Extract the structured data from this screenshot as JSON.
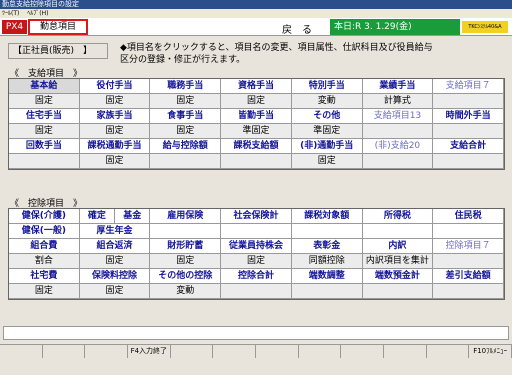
{
  "window": {
    "title": "勤怠支給控除項目の設定"
  },
  "menubar": {
    "items": [
      "ﾂｰﾙ(T)",
      "ﾍﾙﾌﾟ(H)"
    ]
  },
  "header": {
    "tag": "PX4",
    "mode": "勤怠項目",
    "back": "戻　る",
    "today": "本日:R 3. 1.29(金)",
    "system": "TKCｼｽﾃﾑ40&A"
  },
  "staff_category": "【正社員(販売)　】",
  "instruction": "◆項目名をクリックすると、項目名の変更、項目属性、仕訳科目及び役員給与区分の登録・修正が行えます。",
  "payment": {
    "title": "《　支給項目　》",
    "rows": [
      {
        "labels": [
          "基本給",
          "役付手当",
          "職務手当",
          "資格手当",
          "特別手当",
          "業績手当",
          "支給項目７"
        ],
        "values": [
          "固定",
          "固定",
          "固定",
          "固定",
          "変動",
          "計算式",
          ""
        ]
      },
      {
        "labels": [
          "住宅手当",
          "家族手当",
          "食事手当",
          "皆勤手当",
          "その他",
          "支給項目13",
          "時間外手当"
        ],
        "values": [
          "固定",
          "固定",
          "固定",
          "準固定",
          "準固定",
          "",
          ""
        ]
      },
      {
        "labels": [
          "回数手当",
          "課税通勤手当",
          "給与控除額",
          "課税支給額",
          "(非)通勤手当",
          "(非)支給20",
          "支給合計"
        ],
        "values": [
          "",
          "固定",
          "",
          "",
          "固定",
          "",
          ""
        ]
      }
    ]
  },
  "deduction": {
    "title": "《　控除項目　》",
    "rows": [
      {
        "labels": [
          "健保(介護)",
          "確定|基金",
          "雇用保険",
          "社会保険計",
          "課税対象額",
          "所得税",
          "住民税"
        ]
      },
      {
        "labels": [
          "健保(一般)",
          "厚生年金",
          "",
          "",
          "",
          "",
          ""
        ]
      },
      {
        "labels": [
          "組合費",
          "組合返済",
          "財形貯蓄",
          "従業員持株会",
          "表彰金",
          "内訳",
          "控除項目７"
        ],
        "values": [
          "割合",
          "固定",
          "固定",
          "固定",
          "同額控除",
          "内訳項目を集計",
          ""
        ]
      },
      {
        "labels": [
          "社宅費",
          "保険料控除",
          "その他の控除",
          "控除合計",
          "端数調整",
          "端数預金計",
          "差引支給額"
        ],
        "values": [
          "固定",
          "固定",
          "変動",
          "",
          "",
          "",
          ""
        ]
      }
    ]
  },
  "fkeys": [
    "",
    "",
    "",
    "F4入力終了",
    "",
    "",
    "",
    "",
    "",
    "",
    "",
    "F10ﾌﾙﾒﾆｭｰ"
  ]
}
